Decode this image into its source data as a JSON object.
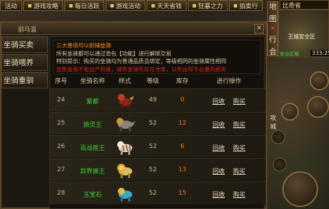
{
  "top_tabs": [
    {
      "label": "活动"
    },
    {
      "label": "游戏攻略"
    },
    {
      "label": "每日活跃"
    },
    {
      "label": "游戏活动"
    },
    {
      "label": "天天省钱"
    },
    {
      "label": "狂暴之力"
    },
    {
      "label": "拍卖行"
    }
  ],
  "dialog": {
    "title": "驯马温",
    "close_label": "✕",
    "side_menu": [
      {
        "label": "坐骑买卖"
      },
      {
        "label": "坐骑喂养"
      },
      {
        "label": "坐骑重驯"
      }
    ],
    "info": {
      "title": "三大兽场可以抓捕坐骑",
      "line1": "所有坐骑都可以通过背包【功能】进行解绑交易",
      "line2": "特别提示：购买的坐骑均为普通品质且绑定，等级相同的坐骑属性相同",
      "line3": "出售坐骑不能出产到暴，请将坐骑先存在仓库，以免出现不必要的损失"
    },
    "table": {
      "headers": [
        "序号",
        "坐骑名称",
        "样式",
        "等级",
        "库存",
        "进行操作"
      ],
      "rows": [
        {
          "no": "24",
          "name": "紫都",
          "level": "49",
          "stock": "0",
          "recycle": "回收",
          "buy": "购买"
        },
        {
          "no": "25",
          "name": "狼灵王",
          "level": "52",
          "stock": "12",
          "recycle": "回收",
          "buy": "购买"
        },
        {
          "no": "26",
          "name": "百战兽王",
          "level": "52",
          "stock": "6",
          "recycle": "回收",
          "buy": "购买"
        },
        {
          "no": "27",
          "name": "异界狮王",
          "level": "52",
          "stock": "13",
          "recycle": "回收",
          "buy": "购买"
        },
        {
          "no": "28",
          "name": "玉宝石",
          "level": "52",
          "stock": "15",
          "recycle": "回收",
          "buy": "购买"
        }
      ]
    }
  },
  "hud": {
    "vertical_tab": {
      "chars": [
        "地",
        "图",
        "行",
        "会"
      ],
      "close": "✕"
    },
    "map_name": "比奇省",
    "safe_zone": "王城安全区",
    "coords_label": "安全区域",
    "coords": "333:258",
    "side_chars": {
      "a": "攻",
      "b": "城"
    }
  },
  "colors": {
    "name_green": "#3bd23b",
    "stock_orange": "#f07a1e",
    "info_title": "#ff8e2a",
    "warning_red": "#e02020"
  }
}
